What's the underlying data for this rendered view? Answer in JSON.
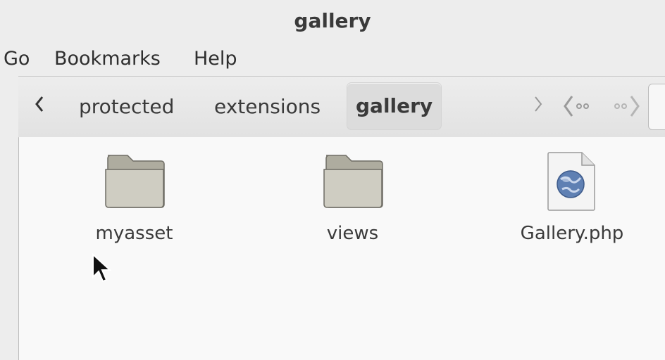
{
  "window": {
    "title": "gallery"
  },
  "menu": {
    "items": [
      "Go",
      "Bookmarks",
      "Help"
    ]
  },
  "pathbar": {
    "crumbs": [
      "protected",
      "extensions",
      "gallery"
    ],
    "active_index": 2
  },
  "files": [
    {
      "name": "myasset",
      "type": "folder",
      "icon": "folder-icon"
    },
    {
      "name": "views",
      "type": "folder",
      "icon": "folder-icon"
    },
    {
      "name": "Gallery.php",
      "type": "file",
      "icon": "php-file-icon"
    }
  ],
  "colors": {
    "background": "#ededed",
    "content": "#f9f9f9",
    "folder": "#c8c6ba"
  }
}
